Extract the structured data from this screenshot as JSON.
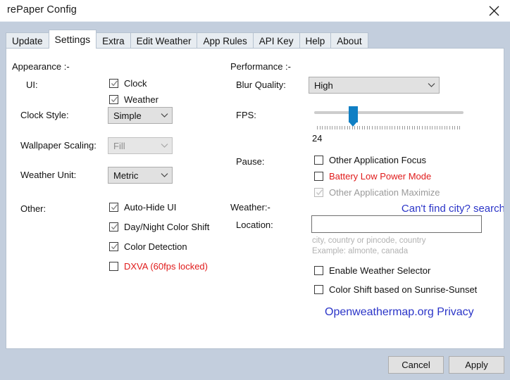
{
  "window": {
    "title": "rePaper Config",
    "close_icon": "close-icon"
  },
  "tabs": [
    {
      "label": "Update",
      "active": false
    },
    {
      "label": "Settings",
      "active": true
    },
    {
      "label": "Extra",
      "active": false
    },
    {
      "label": "Edit Weather",
      "active": false
    },
    {
      "label": "App Rules",
      "active": false
    },
    {
      "label": "API Key",
      "active": false
    },
    {
      "label": "Help",
      "active": false
    },
    {
      "label": "About",
      "active": false
    }
  ],
  "appearance": {
    "section_label": "Appearance :-",
    "ui_label": "UI:",
    "ui_options": [
      {
        "label": "Clock",
        "checked": true
      },
      {
        "label": "Weather",
        "checked": true
      }
    ],
    "clock_style_label": "Clock Style:",
    "clock_style_value": "Simple",
    "wallpaper_scaling_label": "Wallpaper Scaling:",
    "wallpaper_scaling_value": "Fill",
    "weather_unit_label": "Weather Unit:",
    "weather_unit_value": "Metric",
    "other_label": "Other:",
    "other_options": [
      {
        "label": "Auto-Hide UI",
        "checked": true,
        "red": false
      },
      {
        "label": "Day/Night Color Shift",
        "checked": true,
        "red": false
      },
      {
        "label": "Color Detection",
        "checked": true,
        "red": false
      },
      {
        "label": "DXVA (60fps locked)",
        "checked": false,
        "red": true
      }
    ]
  },
  "performance": {
    "section_label": "Performance :-",
    "blur_quality_label": "Blur Quality:",
    "blur_quality_value": "High",
    "fps_label": "FPS:",
    "fps_value": "24",
    "pause_label": "Pause:",
    "pause_options": [
      {
        "label": "Other Application Focus",
        "checked": false,
        "red": false,
        "disabled": false
      },
      {
        "label": "Battery Low Power Mode",
        "checked": false,
        "red": true,
        "disabled": false
      },
      {
        "label": "Other Application Maximize",
        "checked": true,
        "red": false,
        "disabled": true
      }
    ]
  },
  "weather": {
    "section_label": "Weather:-",
    "location_label": "Location:",
    "location_value": "",
    "location_placeholder": "",
    "search_link": "Can't find city? search",
    "hint_line1": "city, country or pincode, country",
    "hint_line2": "Example: almonte, canada",
    "options": [
      {
        "label": "Enable Weather Selector",
        "checked": false
      },
      {
        "label": "Color Shift based on Sunrise-Sunset",
        "checked": false
      }
    ],
    "privacy_link": "Openweathermap.org Privacy"
  },
  "footer": {
    "cancel_label": "Cancel",
    "apply_label": "Apply"
  },
  "colors": {
    "accent": "#0f7fc4",
    "link": "#2b35c8",
    "warning": "#e01b1b",
    "window_chrome": "#c3cedd"
  }
}
